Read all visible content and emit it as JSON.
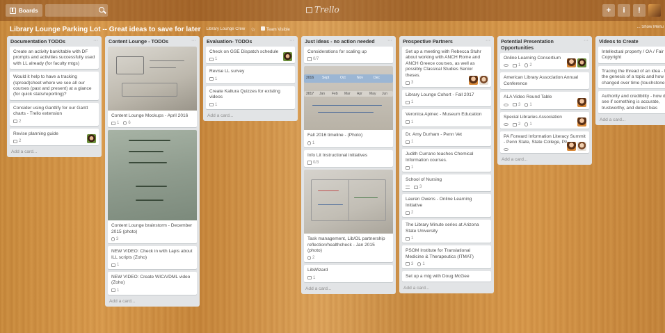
{
  "topbar": {
    "boards_label": "Boards",
    "logo": "Trello",
    "add_btn": "+",
    "info_btn": "i",
    "notif_btn": "!"
  },
  "board": {
    "title": "Library Lounge Parking Lot -- Great ideas to save for later",
    "team": "Library Lounge Crew",
    "visibility": "Team Visible",
    "show_menu": "... Show Menu"
  },
  "add_card_label": "Add a card...",
  "lists": [
    {
      "title": "Documentation TODOs",
      "cards": [
        {
          "text": "Create an activity bank/table with DF prompts and activities successfully used with LL already (for faculty mtgs)",
          "badges": []
        },
        {
          "text": "Would it help to have a tracking (spread)sheet where we see all our courses (past and present) at a glance (for quick stats/reporting)?",
          "badges": []
        },
        {
          "text": "Consider using Ganttify for our Gantt charts - Trello extension",
          "badges": [
            "2"
          ]
        },
        {
          "text": "Revise planning guide",
          "badges": [
            "2"
          ]
        }
      ]
    },
    {
      "title": "Content Lounge - TODOs",
      "cards": [
        {
          "text": "Content Lounge Mockups - April 2016",
          "badges": [
            "1",
            "6"
          ]
        },
        {
          "text": "Content Lounge brainstorm - December 2015 (photo)",
          "badges": [
            "3"
          ]
        },
        {
          "text": "NEW VIDEO: Check in with Lapis about ILL scripts (Zoho)",
          "badges": [
            "1"
          ]
        },
        {
          "text": "NEW VIDEO: Create WIC/VDML video (Zoho)",
          "badges": [
            "1"
          ]
        }
      ]
    },
    {
      "title": "Evaluation- TODOs",
      "cards": [
        {
          "text": "Check on GSE Dispatch schedule",
          "badges": [
            "1"
          ]
        },
        {
          "text": "Revise LL survey",
          "badges": [
            "1"
          ]
        },
        {
          "text": "Create Kaltura Quizzes for existing videos",
          "badges": [
            "1"
          ]
        }
      ]
    },
    {
      "title": "Just ideas - no action needed",
      "cards": [
        {
          "text": "Considerations for scaling up",
          "badges": [
            "0/7"
          ]
        },
        {
          "text": "Fall 2016 timeline - (Photo)",
          "badges": [
            "1"
          ]
        },
        {
          "text": "Info Lit Instructional initiatives",
          "badges": [
            "0/3"
          ]
        },
        {
          "text": "Task management, Lib/OL partnership reflection/healthcheck - Jan 2015 (photo)",
          "badges": [
            "2"
          ]
        },
        {
          "text": "LibWizard",
          "badges": [
            "1"
          ]
        }
      ],
      "timeline_labels": [
        "2016",
        "Sept",
        "Oct",
        "Nov",
        "Dec",
        "2017",
        "Jan",
        "Feb",
        "Mar",
        "Apr",
        "May",
        "Jun"
      ]
    },
    {
      "title": "Prospective Partners",
      "cards": [
        {
          "text": "Set up a meeting with Rebecca Stuhr about working with ANCH Rome and ANCH Greece courses, as well as possibly Classical Studies Senior theses.",
          "badges": [
            "3"
          ]
        },
        {
          "text": "Library Lounge Cohort - Fall 2017",
          "badges": [
            "1"
          ]
        },
        {
          "text": "Veronica Apinec - Museum Education",
          "badges": [
            "1"
          ]
        },
        {
          "text": "Dr. Amy Durham - Penn Vet",
          "badges": [
            "1"
          ]
        },
        {
          "text": "Judith Currano teaches Chemical Information courses.",
          "badges": [
            "1"
          ]
        },
        {
          "text": "School of Nursing",
          "badges": [
            "3"
          ]
        },
        {
          "text": "Lauren Owens - Online Learning Initiative",
          "badges": [
            "2"
          ]
        },
        {
          "text": "The Library Minute series at Arizona State University",
          "badges": [
            "1"
          ]
        },
        {
          "text": "PSOM Institute for Translational Medicine & Therapeutics (ITMAT)",
          "badges": [
            "3",
            "1"
          ]
        },
        {
          "text": "Set up a mtg with Doug McGee",
          "badges": []
        }
      ]
    },
    {
      "title": "Potential Presentation Opportunities",
      "cards": [
        {
          "text": "Online Learning Consortium",
          "badges": [
            "1",
            "2"
          ]
        },
        {
          "text": "American Library Association Annual Conference",
          "badges": []
        },
        {
          "text": "ALA Video Round Table",
          "badges": [
            "3",
            "1"
          ]
        },
        {
          "text": "Special Libraries Association",
          "badges": [
            "2",
            "1"
          ]
        },
        {
          "text": "PA Forward Information Literacy Summit - Penn State, State College, PA",
          "badges": []
        }
      ]
    },
    {
      "title": "Videos to Create",
      "cards": [
        {
          "text": "Intellectual property / OA / Fair use / Copyright",
          "badges": []
        },
        {
          "text": "Tracing the thread of an idea - following the genesis of a topic and how it's changed over time (touchstone pieces)",
          "badges": []
        },
        {
          "text": "Authority and credibility - how do you see if something is accurate, trustworthy, and detect bias",
          "badges": []
        }
      ]
    }
  ]
}
